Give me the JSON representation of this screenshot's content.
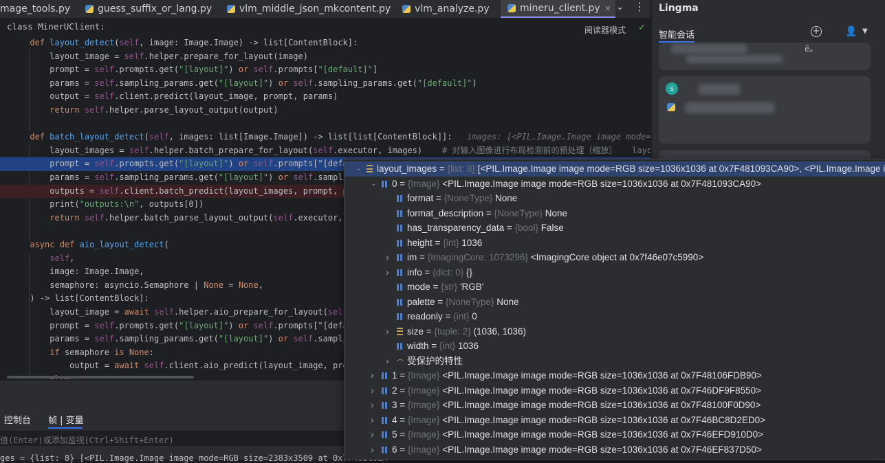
{
  "tabs": [
    {
      "label": "mage_tools.py"
    },
    {
      "label": "guess_suffix_or_lang.py"
    },
    {
      "label": "vlm_middle_json_mkcontent.py"
    },
    {
      "label": "vlm_analyze.py"
    },
    {
      "label": "mineru_client.py",
      "active": true,
      "close": "×"
    }
  ],
  "tab_more": "⌄",
  "tab_dots": "⋮",
  "editor": {
    "breadcrumb": "class MinerUClient:",
    "reader_mode": "阅读器模式",
    "check": "✓"
  },
  "code_lines": [
    "    def layout_detect(self, image: Image.Image) -> list[ContentBlock]:",
    "        layout_image = self.helper.prepare_for_layout(image)",
    "        prompt = self.prompts.get(\"[layout]\") or self.prompts[\"[default]\"]",
    "        params = self.sampling_params.get(\"[layout]\") or self.sampling_params.get(\"[default]\")",
    "        output = self.client.predict(layout_image, prompt, params)",
    "        return self.helper.parse_layout_output(output)",
    "",
    "    def batch_layout_detect(self, images: list[Image.Image]) -> list[list[ContentBlock]]:",
    "        layout_images = self.helper.batch_prepare_for_layout(self.executor, images)",
    "        prompt = self.prompts.get(\"[layout]\") or self.prompts[\"[defa",
    "        params = self.sampling_params.get(\"[layout]\") or self.sampli",
    "        outputs = self.client.batch_predict(layout_images, prompt, pa",
    "        print(\"outputs:\\n\", outputs[0])",
    "        return self.helper.batch_parse_layout_output(self.executor, o",
    "",
    "    async def aio_layout_detect(",
    "        self,",
    "        image: Image.Image,",
    "        semaphore: asyncio.Semaphore | None = None,",
    "    ) -> list[ContentBlock]:",
    "        layout_image = await self.helper.aio_prepare_for_layout(self",
    "        prompt = self.prompts.get(\"[layout]\") or self.prompts[\"[defa",
    "        params = self.sampling_params.get(\"[layout]\") or self.sampli",
    "        if semaphore is None:",
    "            output = await self.client.aio_predict(layout_image, prom",
    "        else:"
  ],
  "inline_hints": {
    "batch_layout_detect": "images: [<PIL.Image.Image image mode=RGB",
    "batch_prepare": "# 对输入图像进行布局检测前的预处理（缩放）   layout"
  },
  "bottom_panel": {
    "console_tab": "控制台",
    "frames_tab": "帧 | 变量",
    "eval_placeholder": "值(Enter)或添加监视(Ctrl+Shift+Enter)",
    "var_row": "ges = {list: 8} [<PIL.Image.Image image mode=RGB size=2383x3509 at 0x7F46BC8EA"
  },
  "right_panel": {
    "title": "Lingma",
    "smart_chat": "智能会话",
    "plus_icon": "+",
    "user_icon": "👤",
    "caret": "▼",
    "card_snippet": "ё。",
    "avatar_letter": "s"
  },
  "debug_popup": {
    "rows": [
      {
        "name": "layout_images",
        "eq": " = ",
        "type": "{list: 8}",
        "val": " [<PIL.Image.Image image mode=RGB size=1036x1036 at 0x7F481093CA90>, <PIL.Image.Image ima"
      },
      {
        "name": "0",
        "eq": " = ",
        "type": "{Image}",
        "val": " <PIL.Image.Image image mode=RGB size=1036x1036 at 0x7F481093CA90>"
      },
      {
        "name": "format",
        "eq": " = ",
        "type": "{NoneType}",
        "val": " None"
      },
      {
        "name": "format_description",
        "eq": " = ",
        "type": "{NoneType}",
        "val": " None"
      },
      {
        "name": "has_transparency_data",
        "eq": " = ",
        "type": "{bool}",
        "val": " False"
      },
      {
        "name": "height",
        "eq": " = ",
        "type": "{int}",
        "val": " 1036"
      },
      {
        "name": "im",
        "eq": " = ",
        "type": "{ImagingCore: 1073296}",
        "val": " <ImagingCore object at 0x7f46e07c5990>"
      },
      {
        "name": "info",
        "eq": " = ",
        "type": "{dict: 0}",
        "val": " {}"
      },
      {
        "name": "mode",
        "eq": " = ",
        "type": "{str}",
        "val": " 'RGB'"
      },
      {
        "name": "palette",
        "eq": " = ",
        "type": "{NoneType}",
        "val": " None"
      },
      {
        "name": "readonly",
        "eq": " = ",
        "type": "{int}",
        "val": " 0"
      },
      {
        "name": "size",
        "eq": " = ",
        "type": "{tuple: 2}",
        "val": " (1036, 1036)"
      },
      {
        "name": "width",
        "eq": " = ",
        "type": "{int}",
        "val": " 1036"
      },
      {
        "name": "受保护的特性",
        "eq": "",
        "type": "",
        "val": ""
      },
      {
        "name": "1",
        "eq": " = ",
        "type": "{Image}",
        "val": " <PIL.Image.Image image mode=RGB size=1036x1036 at 0x7F48106FDB90>"
      },
      {
        "name": "2",
        "eq": " = ",
        "type": "{Image}",
        "val": " <PIL.Image.Image image mode=RGB size=1036x1036 at 0x7F46DF9F8550>"
      },
      {
        "name": "3",
        "eq": " = ",
        "type": "{Image}",
        "val": " <PIL.Image.Image image mode=RGB size=1036x1036 at 0x7F48100F0D90>"
      },
      {
        "name": "4",
        "eq": " = ",
        "type": "{Image}",
        "val": " <PIL.Image.Image image mode=RGB size=1036x1036 at 0x7F46BC8D2ED0>"
      },
      {
        "name": "5",
        "eq": " = ",
        "type": "{Image}",
        "val": " <PIL.Image.Image image mode=RGB size=1036x1036 at 0x7F46EFD910D0>"
      },
      {
        "name": "6",
        "eq": " = ",
        "type": "{Image}",
        "val": " <PIL.Image.Image image mode=RGB size=1036x1036 at 0x7F46EF837D50>"
      }
    ]
  },
  "colors": {
    "editor_bg": "#1e1f22",
    "panel_bg": "#2b2d30",
    "selection": "#214283",
    "accent": "#3574f0"
  }
}
